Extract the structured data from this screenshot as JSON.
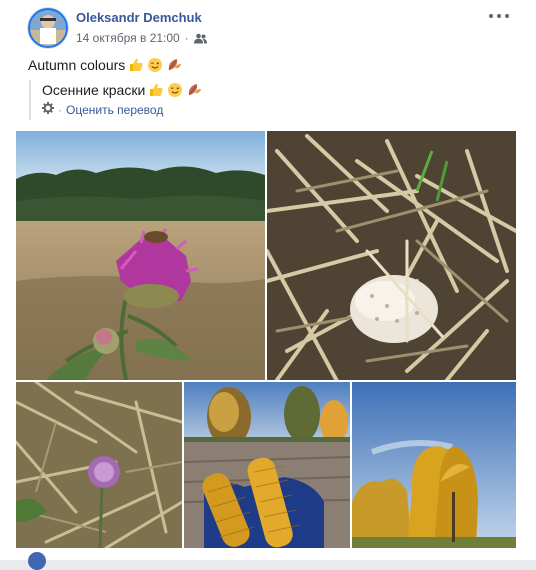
{
  "post": {
    "author": "Oleksandr Demchuk",
    "timestamp": "14 октября в 21:00",
    "separator": "·",
    "audience_icon": "friends-icon",
    "more_icon": "more-dots-icon",
    "text": "Autumn colours",
    "emojis": [
      "thumbs-up-emoji",
      "wink-emoji",
      "fallen-leaf-emoji"
    ],
    "translation": {
      "text": "Осенние краски",
      "rate_label": "Оценить перевод",
      "separator": "·",
      "settings_icon": "gear-icon"
    },
    "photos": [
      {
        "name": "thistle-field-photo"
      },
      {
        "name": "puffball-mushroom-photo"
      },
      {
        "name": "small-thistle-photo"
      },
      {
        "name": "corn-cobs-photo"
      },
      {
        "name": "golden-trees-photo"
      }
    ]
  },
  "colors": {
    "link": "#385898",
    "meta": "#616770",
    "text": "#1c1e21",
    "background": "#e9ebee"
  }
}
